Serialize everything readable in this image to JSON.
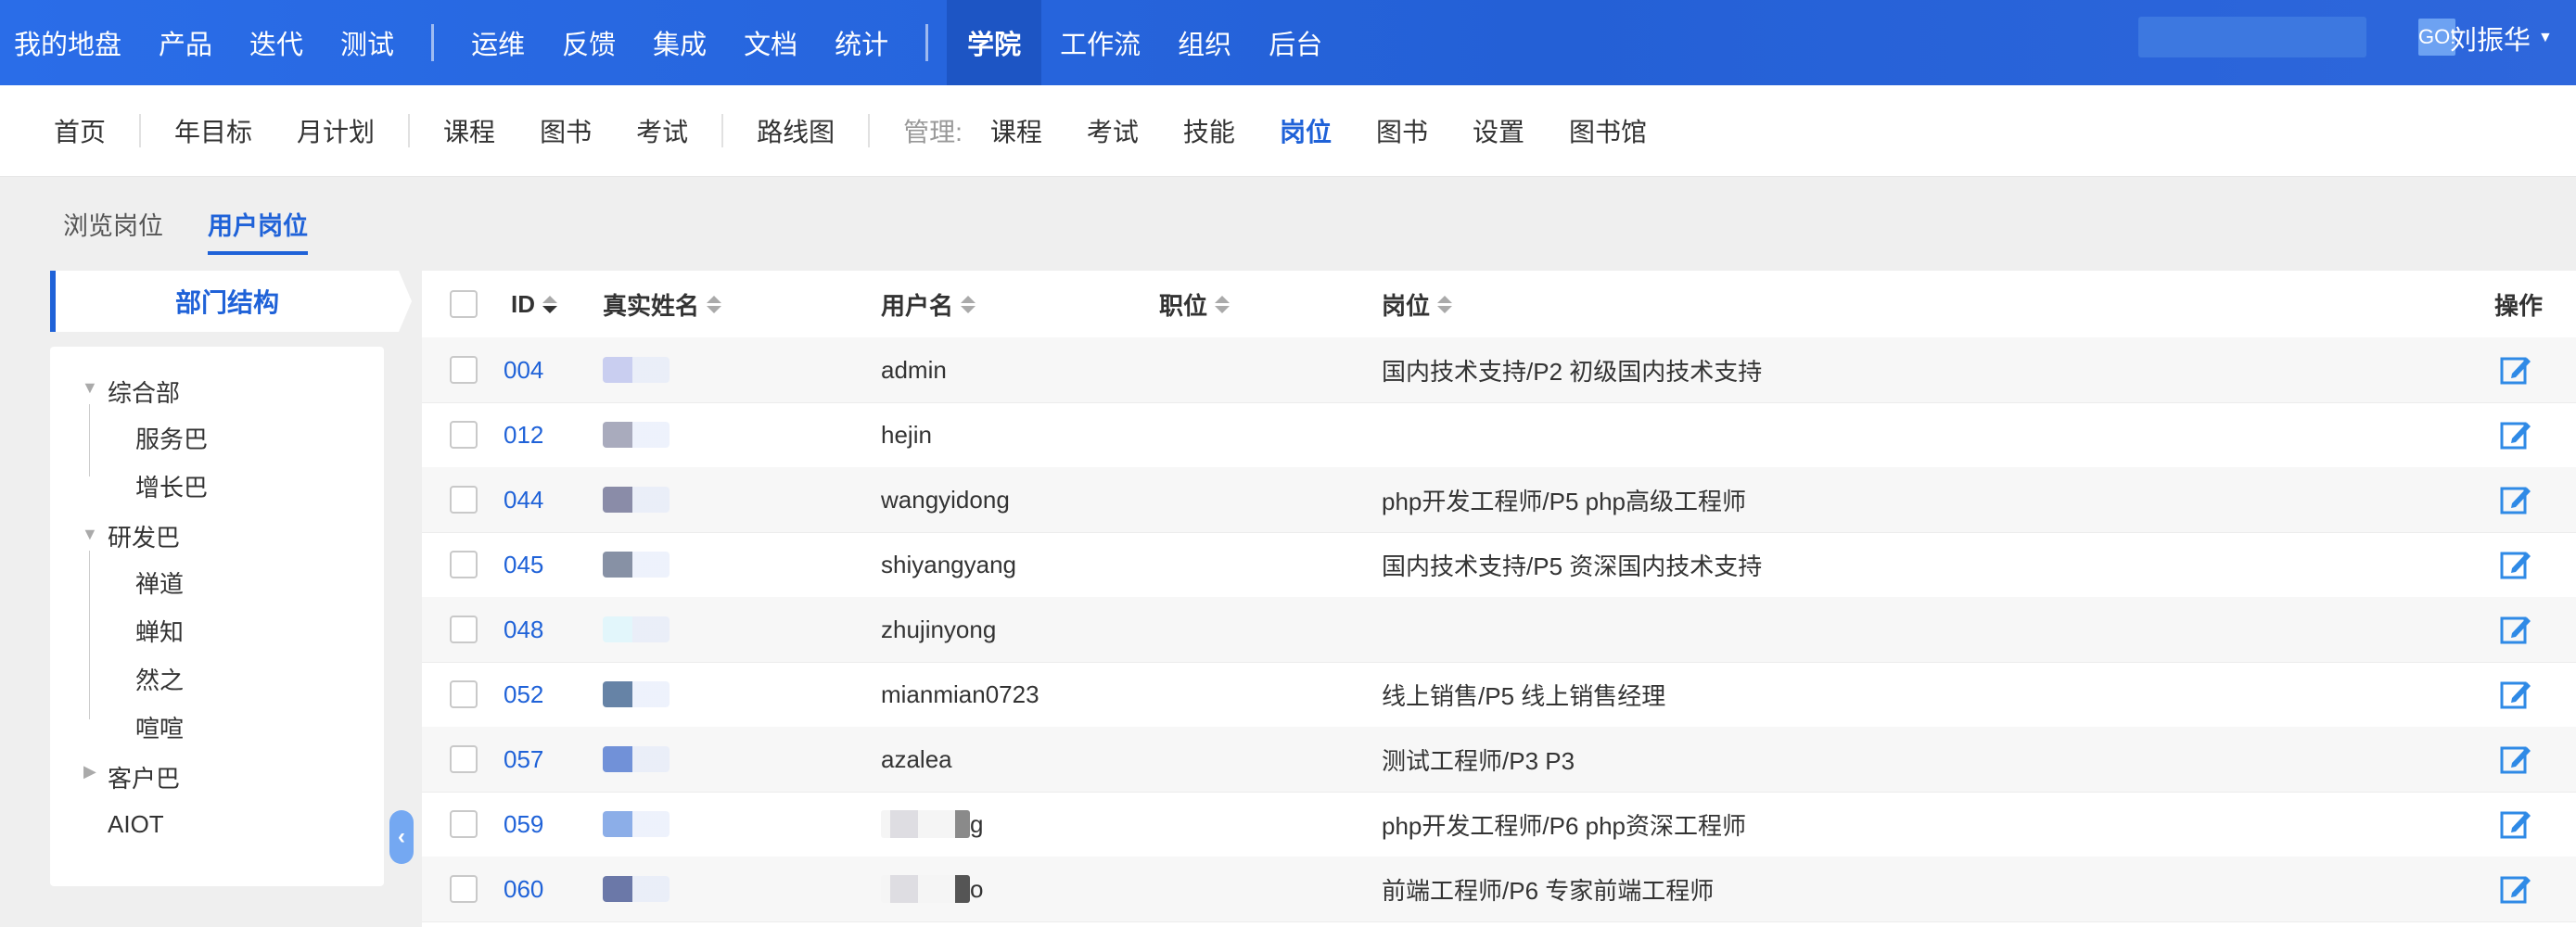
{
  "topnav": {
    "items": [
      "我的地盘",
      "产品",
      "迭代",
      "测试",
      "运维",
      "反馈",
      "集成",
      "文档",
      "统计",
      "学院",
      "工作流",
      "组织",
      "后台"
    ],
    "active": "学院",
    "search_placeholder": "",
    "search_button": "GO!",
    "user": "刘振华"
  },
  "subnav": {
    "items_group1": [
      "首页"
    ],
    "items_group2": [
      "年目标",
      "月计划"
    ],
    "items_group3": [
      "课程",
      "图书",
      "考试"
    ],
    "items_group4": [
      "路线图"
    ],
    "manage_label": "管理:",
    "items_manage": [
      "课程",
      "考试",
      "技能",
      "岗位",
      "图书",
      "设置",
      "图书馆"
    ],
    "active": "岗位"
  },
  "tabs": [
    "浏览岗位",
    "用户岗位"
  ],
  "active_tab": "用户岗位",
  "sidebar": {
    "header": "部门结构",
    "tree": [
      {
        "label": "综合部",
        "children": [
          "服务巴",
          "增长巴"
        ]
      },
      {
        "label": "研发巴",
        "children": [
          "禅道",
          "蝉知",
          "然之",
          "喧喧"
        ]
      },
      {
        "label": "客户巴",
        "children": []
      },
      {
        "label": "AIOT",
        "children": []
      }
    ]
  },
  "table": {
    "columns": {
      "id": "ID",
      "realname": "真实姓名",
      "username": "用户名",
      "position": "职位",
      "post": "岗位",
      "actions": "操作"
    },
    "rows": [
      {
        "id": "004",
        "username": "admin",
        "post": "国内技术支持/P2 初级国内技术支持"
      },
      {
        "id": "012",
        "username": "hejin",
        "post": ""
      },
      {
        "id": "044",
        "username": "wangyidong",
        "post": "php开发工程师/P5 php高级工程师"
      },
      {
        "id": "045",
        "username": "shiyangyang",
        "post": "国内技术支持/P5 资深国内技术支持"
      },
      {
        "id": "048",
        "username": "zhujinyong",
        "post": ""
      },
      {
        "id": "052",
        "username": "mianmian0723",
        "post": "线上销售/P5 线上销售经理"
      },
      {
        "id": "057",
        "username": "azalea",
        "post": "测试工程师/P3 P3"
      },
      {
        "id": "059",
        "username": "g",
        "post": "php开发工程师/P6 php资深工程师"
      },
      {
        "id": "060",
        "username": "o",
        "post": "前端工程师/P6 专家前端工程师"
      }
    ]
  },
  "colors": {
    "primary": "#1f62d8",
    "topbar": "#2a6de8",
    "active_top": "#1d55c4"
  }
}
